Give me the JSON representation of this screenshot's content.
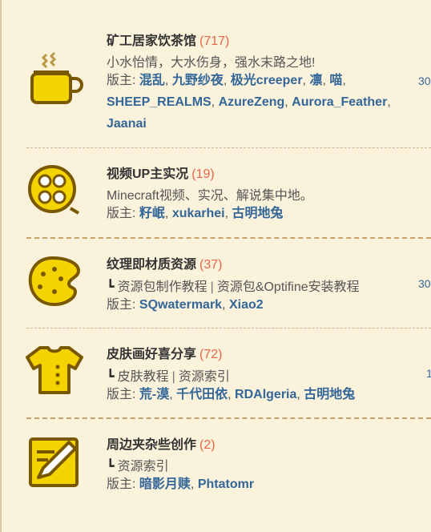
{
  "forums": [
    {
      "title": "矿工居家饮茶馆",
      "count": "(717)",
      "desc": "小水怡情，大水伤身，强水末路之地!",
      "mod_label": "版主:",
      "moderators": [
        "混乱",
        "九野纱夜",
        "极光creeper",
        "凛",
        "喵",
        "SHEEP_REALMS",
        "AzureZeng",
        "Aurora_Feather",
        "Jaanai"
      ],
      "right_value": "30",
      "icon": "teacup-icon"
    },
    {
      "title": "视频UP主实况",
      "count": "(19)",
      "desc": "Minecraft视频、实况、解说集中地。",
      "mod_label": "版主:",
      "moderators": [
        "籽岷",
        "xukarhei",
        "古明地兔"
      ],
      "icon": "film-reel-icon"
    },
    {
      "title": "纹理即材质资源",
      "count": "(37)",
      "sub_forums": [
        "资源包制作教程",
        "资源包&Optifine安装教程"
      ],
      "mod_label": "版主:",
      "moderators": [
        "SQwatermark",
        "Xiao2"
      ],
      "right_value": "30",
      "icon": "palette-icon"
    },
    {
      "title": "皮肤画好喜分享",
      "count": "(72)",
      "sub_forums": [
        "皮肤教程",
        "资源索引"
      ],
      "mod_label": "版主:",
      "moderators": [
        "荒-漠",
        "千代田依",
        "RDAlgeria",
        "古明地兔"
      ],
      "right_value": "1",
      "icon": "tshirt-icon"
    },
    {
      "title": "周边夹杂些创作",
      "count": "(2)",
      "sub_forums": [
        "资源索引"
      ],
      "mod_label": "版主:",
      "moderators": [
        "暗影月赎",
        "Phtatomr"
      ],
      "icon": "pencil-note-icon"
    }
  ],
  "tree_glyph": "┗",
  "separator": "|"
}
